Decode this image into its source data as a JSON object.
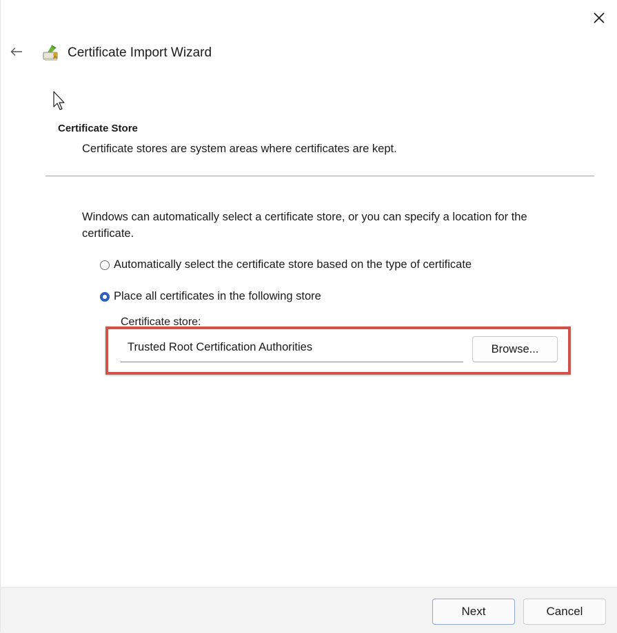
{
  "window": {
    "title": "Certificate Import Wizard",
    "close_icon": "close-icon",
    "back_icon": "back-arrow-icon",
    "title_icon": "certificate-icon"
  },
  "section": {
    "heading": "Certificate Store",
    "description": "Certificate stores are system areas where certificates are kept."
  },
  "main": {
    "intro": "Windows can automatically select a certificate store, or you can specify a location for the certificate.",
    "options": [
      {
        "label": "Automatically select the certificate store based on the type of certificate",
        "selected": false
      },
      {
        "label": "Place all certificates in the following store",
        "selected": true
      }
    ],
    "store_label": "Certificate store:",
    "store_value": "Trusted Root Certification Authorities",
    "browse_label": "Browse...",
    "highlight_color": "#cf5348"
  },
  "footer": {
    "next_label": "Next",
    "cancel_label": "Cancel"
  },
  "colors": {
    "accent": "#2e5fbd",
    "highlight": "#cf5348"
  }
}
